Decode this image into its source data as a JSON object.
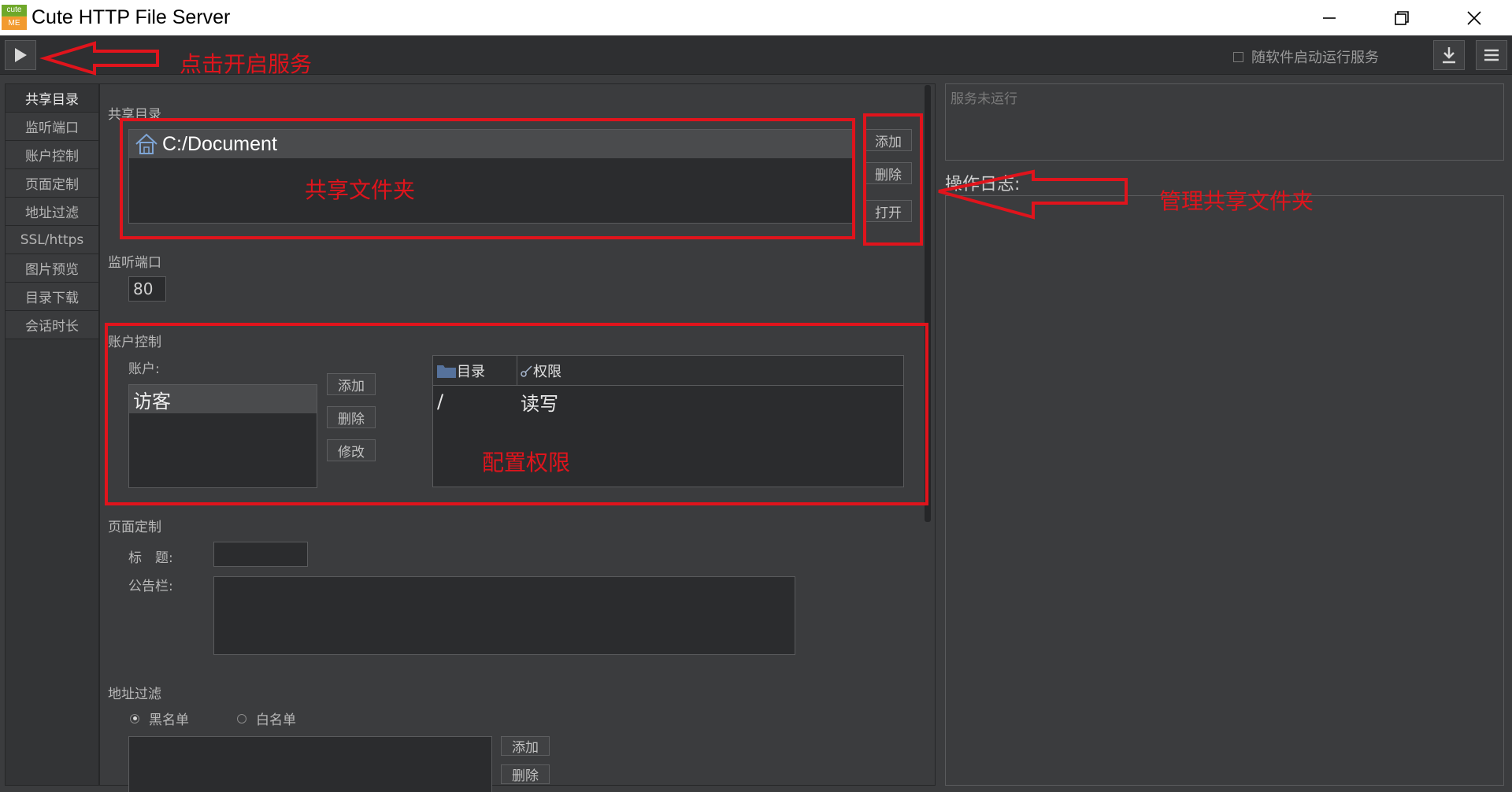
{
  "window": {
    "logo_top": "cute",
    "logo_bottom": "ME",
    "title": "Cute HTTP File Server"
  },
  "toolbar": {
    "autostart_label": "随软件启动运行服务"
  },
  "nav": {
    "items": [
      "共享目录",
      "监听端口",
      "账户控制",
      "页面定制",
      "地址过滤",
      "SSL/https",
      "图片预览",
      "目录下载",
      "会话时长"
    ],
    "active_index": 0
  },
  "share": {
    "label": "共享目录",
    "paths": [
      "C:/Document"
    ],
    "add": "添加",
    "delete": "删除",
    "open": "打开"
  },
  "port": {
    "label": "监听端口",
    "value": "80"
  },
  "accounts": {
    "label": "账户控制",
    "list_label": "账户:",
    "items": [
      "访客"
    ],
    "add": "添加",
    "delete": "删除",
    "edit": "修改",
    "columns": [
      "目录",
      "权限"
    ],
    "rows": [
      {
        "dir": "/",
        "perm": "读写"
      }
    ]
  },
  "page": {
    "label": "页面定制",
    "title_label": "标　题:",
    "title_value": "",
    "notice_label": "公告栏:",
    "notice_value": ""
  },
  "filter": {
    "label": "地址过滤",
    "blacklist": "黑名单",
    "whitelist": "白名单",
    "selected": "blacklist",
    "add": "添加",
    "delete": "删除"
  },
  "status": {
    "text": "服务未运行"
  },
  "log": {
    "label": "操作日志:"
  },
  "annotations": {
    "start_service": "点击开启服务",
    "shared_folder": "共享文件夹",
    "manage_shared": "管理共享文件夹",
    "config_perm": "配置权限"
  },
  "colors": {
    "annotation": "#e0141c",
    "background": "#3b3c3e",
    "selected_row": "#4a4b4d"
  }
}
